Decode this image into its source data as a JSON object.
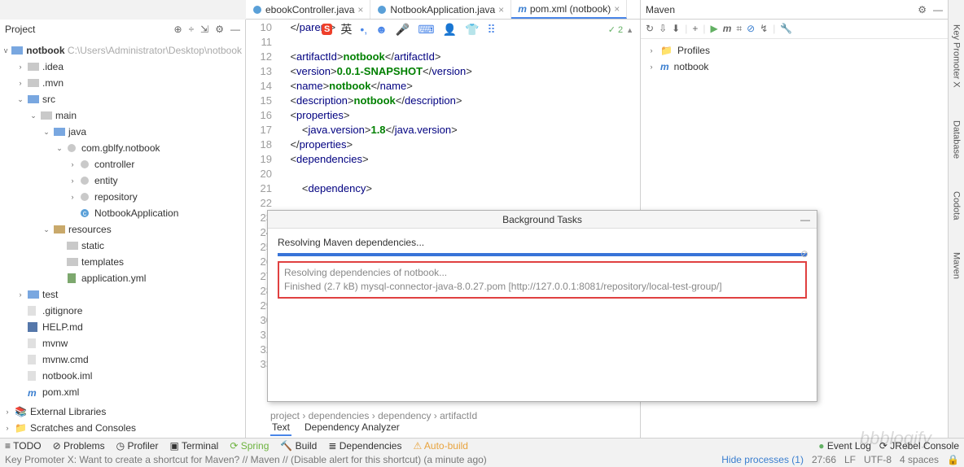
{
  "sidebar": {
    "title": "Project",
    "root": {
      "name": "notbook",
      "path": "C:\\Users\\Administrator\\Desktop\\notbook"
    },
    "tree": [
      {
        "indent": 1,
        "arrow": ">",
        "icon": "folder-grey",
        "label": ".idea"
      },
      {
        "indent": 1,
        "arrow": ">",
        "icon": "folder-grey",
        "label": ".mvn"
      },
      {
        "indent": 1,
        "arrow": "v",
        "icon": "folder-blue",
        "label": "src"
      },
      {
        "indent": 2,
        "arrow": "v",
        "icon": "folder-grey",
        "label": "main"
      },
      {
        "indent": 3,
        "arrow": "v",
        "icon": "folder-blue",
        "label": "java"
      },
      {
        "indent": 4,
        "arrow": "v",
        "icon": "package",
        "label": "com.gblfy.notbook"
      },
      {
        "indent": 5,
        "arrow": ">",
        "icon": "package",
        "label": "controller"
      },
      {
        "indent": 5,
        "arrow": ">",
        "icon": "package",
        "label": "entity"
      },
      {
        "indent": 5,
        "arrow": ">",
        "icon": "package",
        "label": "repository"
      },
      {
        "indent": 5,
        "arrow": "",
        "icon": "class",
        "label": "NotbookApplication"
      },
      {
        "indent": 3,
        "arrow": "v",
        "icon": "folder-res",
        "label": "resources"
      },
      {
        "indent": 4,
        "arrow": "",
        "icon": "folder-grey",
        "label": "static"
      },
      {
        "indent": 4,
        "arrow": "",
        "icon": "folder-grey",
        "label": "templates"
      },
      {
        "indent": 4,
        "arrow": "",
        "icon": "yml",
        "label": "application.yml"
      },
      {
        "indent": 1,
        "arrow": ">",
        "icon": "folder-blue",
        "label": "test"
      },
      {
        "indent": 1,
        "arrow": "",
        "icon": "file",
        "label": ".gitignore"
      },
      {
        "indent": 1,
        "arrow": "",
        "icon": "md",
        "label": "HELP.md"
      },
      {
        "indent": 1,
        "arrow": "",
        "icon": "file",
        "label": "mvnw"
      },
      {
        "indent": 1,
        "arrow": "",
        "icon": "file",
        "label": "mvnw.cmd"
      },
      {
        "indent": 1,
        "arrow": "",
        "icon": "file",
        "label": "notbook.iml"
      },
      {
        "indent": 1,
        "arrow": "",
        "icon": "maven",
        "label": "pom.xml"
      }
    ],
    "extlib": "External Libraries",
    "scratch": "Scratches and Consoles"
  },
  "tabs": [
    {
      "label": "ebookController.java",
      "icon": "class",
      "active": false
    },
    {
      "label": "NotbookApplication.java",
      "icon": "class",
      "active": false
    },
    {
      "label": "pom.xml (notbook)",
      "icon": "maven",
      "active": true
    }
  ],
  "code": [
    {
      "n": 10,
      "html": "</<t>parent</t>>"
    },
    {
      "n": 11,
      "html": ""
    },
    {
      "n": 12,
      "html": "<<t>artifactId</t>><x>notbook</x></<t>artifactId</t>>"
    },
    {
      "n": 13,
      "html": "<<t>version</t>><x>0.0.1-SNAPSHOT</x></<t>version</t>>"
    },
    {
      "n": 14,
      "html": "<<t>name</t>><x>notbook</x></<t>name</t>>"
    },
    {
      "n": 15,
      "html": "<<t>description</t>><x>notbook</x></<t>description</t>>"
    },
    {
      "n": 16,
      "html": "<<t>properties</t>>"
    },
    {
      "n": 17,
      "html": "    <<t>java.version</t>><x>1.8</x></<t>java.version</t>>"
    },
    {
      "n": 18,
      "html": "</<t>properties</t>>"
    },
    {
      "n": 19,
      "html": "<<t>dependencies</t>>"
    },
    {
      "n": 20,
      "html": ""
    },
    {
      "n": 21,
      "html": "    <<t>dependency</t>>"
    },
    {
      "n": 22,
      "html": ""
    },
    {
      "n": 23,
      "html": ""
    },
    {
      "n": 24,
      "html": ""
    },
    {
      "n": 25,
      "html": ""
    },
    {
      "n": 26,
      "html": ""
    },
    {
      "n": 27,
      "html": ""
    },
    {
      "n": 28,
      "html": ""
    },
    {
      "n": 29,
      "html": ""
    },
    {
      "n": 30,
      "html": ""
    },
    {
      "n": 31,
      "html": ""
    },
    {
      "n": 32,
      "html": ""
    },
    {
      "n": 33,
      "html": ""
    }
  ],
  "tick": "✓ 2",
  "maven": {
    "title": "Maven",
    "profiles": "Profiles",
    "module": "notbook"
  },
  "popup": {
    "title": "Background Tasks",
    "label": "Resolving Maven dependencies...",
    "line1": "Resolving dependencies of notbook...",
    "line2": "Finished (2.7 kB) mysql-connector-java-8.0.27.pom [http://127.0.0.1:8081/repository/local-test-group/]"
  },
  "breadcrumb": "project  ›  dependencies  ›  dependency  ›  artifactId",
  "subtabs": {
    "text": "Text",
    "dep": "Dependency Analyzer"
  },
  "status": {
    "items": [
      "TODO",
      "Problems",
      "Profiler",
      "Terminal",
      "Spring",
      "Build",
      "Dependencies",
      "Auto-build"
    ],
    "right": {
      "event": "Event Log",
      "rebel": "JRebel Console"
    },
    "hide": "Hide processes (1)",
    "pos": "27:66",
    "lf": "LF",
    "enc": "UTF-8",
    "sp": "4 spaces"
  },
  "hint": "Key Promoter X: Want to create a shortcut for Maven? // Maven // (Disable alert for this shortcut) (a minute ago)",
  "rightStrip": [
    "Key Promoter X",
    "Database",
    "Codota",
    "Maven"
  ],
  "wm": "bbblogify"
}
